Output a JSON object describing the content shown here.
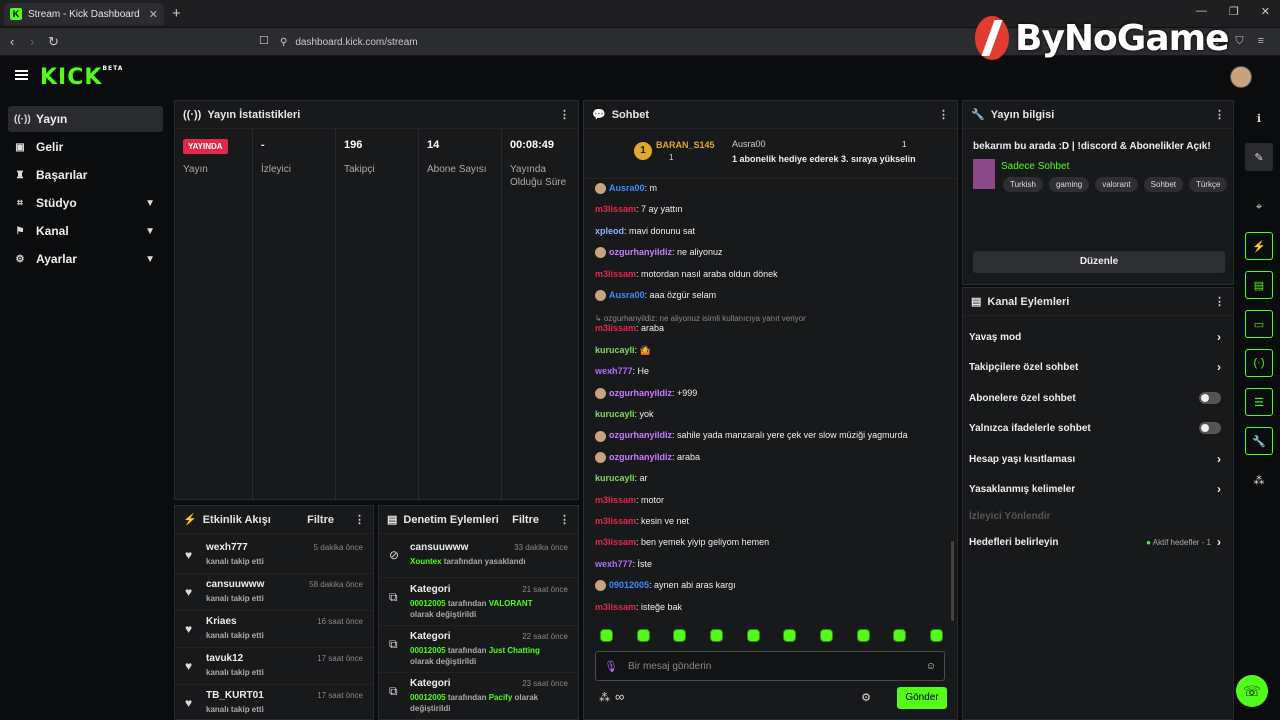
{
  "browser": {
    "tab_title": "Stream - Kick Dashboard",
    "url": "dashboard.kick.com/stream"
  },
  "watermark": "ByNoGame",
  "logo": "KICK",
  "logo_badge": "BETA",
  "nav": [
    {
      "label": "Yayın",
      "icon": "broadcast-icon",
      "active": true
    },
    {
      "label": "Gelir",
      "icon": "revenue-icon"
    },
    {
      "label": "Başarılar",
      "icon": "trophy-icon"
    },
    {
      "label": "Stüdyo",
      "icon": "studio-icon",
      "expandable": true
    },
    {
      "label": "Kanal",
      "icon": "channel-icon",
      "expandable": true
    },
    {
      "label": "Ayarlar",
      "icon": "gear-icon",
      "expandable": true
    }
  ],
  "stats": {
    "title": "Yayın İstatistikleri",
    "live_badge": "YAYINDA",
    "columns": [
      {
        "value": "",
        "label": "Yayın"
      },
      {
        "value": "-",
        "label": "İzleyici"
      },
      {
        "value": "196",
        "label": "Takipçi"
      },
      {
        "value": "14",
        "label": "Abone Sayısı"
      },
      {
        "value": "00:08:49",
        "label": "Yayında Olduğu Süre"
      }
    ]
  },
  "activity": {
    "title": "Etkinlik Akışı",
    "filter": "Filtre",
    "items": [
      {
        "name": "wexh777",
        "sub": "kanalı takip etti",
        "time": "5 dakika önce"
      },
      {
        "name": "cansuuwww",
        "sub": "kanalı takip etti",
        "time": "58 dakika önce"
      },
      {
        "name": "Kriaes",
        "sub": "kanalı takip etti",
        "time": "16 saat önce"
      },
      {
        "name": "tavuk12",
        "sub": "kanalı takip etti",
        "time": "17 saat önce"
      },
      {
        "name": "TB_KURT01",
        "sub": "kanalı takip etti",
        "time": "17 saat önce"
      }
    ]
  },
  "moderation": {
    "title": "Denetim Eylemleri",
    "filter": "Filtre",
    "items": [
      {
        "name": "cansuuwww",
        "by": "Xountex",
        "rest": " tarafından yasaklandı",
        "time": "33 dakika önce",
        "icon": "ban-icon"
      },
      {
        "name": "Kategori",
        "by": "00012005",
        "mid": " tarafından ",
        "cat": "VALORANT",
        "rest": " olarak değiştirildi",
        "time": "21 saat önce",
        "icon": "category-icon"
      },
      {
        "name": "Kategori",
        "by": "00012005",
        "mid": " tarafından ",
        "cat": "Just Chatting",
        "rest": " olarak değiştirildi",
        "time": "22 saat önce",
        "icon": "category-icon"
      },
      {
        "name": "Kategori",
        "by": "00012005",
        "mid": " tarafından ",
        "cat": "Pacify",
        "rest": " olarak değiştirildi",
        "time": "23 saat önce",
        "icon": "category-icon"
      }
    ]
  },
  "chat": {
    "title": "Sohbet",
    "pinned": {
      "rank": "1",
      "user1": "BARAN_S145",
      "count1": "1",
      "user2": "Ausra00",
      "message": "1 abonelik hediye ederek 3. sıraya yükselin",
      "count2": "1"
    },
    "messages": [
      {
        "user": "Ausra00",
        "color": "#3d8bff",
        "text": ": m",
        "avatar": true
      },
      {
        "user": "m3lissam",
        "color": "#e0284a",
        "text": ": 7 ay yattın"
      },
      {
        "user": "xpleod",
        "color": "#8fb3ff",
        "text": ": mavi donunu sat"
      },
      {
        "user": "ozgurhanyildiz",
        "color": "#c77dff",
        "text": ": ne aliyonuz",
        "avatar": true
      },
      {
        "user": "m3lissam",
        "color": "#e0284a",
        "text": ": motordan nasıl araba oldun dönek"
      },
      {
        "user": "Ausra00",
        "color": "#3d8bff",
        "text": ": aaa özgür selam",
        "avatar": true
      },
      {
        "reply": "ozgurhanyildiz: ne aliyonuz isimli kullanıcıya yanıt veriyor"
      },
      {
        "user": "m3lissam",
        "color": "#e0284a",
        "text": ": araba"
      },
      {
        "user": "kurucayli",
        "color": "#7ed957",
        "text": ": 🤷"
      },
      {
        "user": "wexh777",
        "color": "#b36bff",
        "text": ": He"
      },
      {
        "user": "ozgurhanyildiz",
        "color": "#c77dff",
        "text": ": +999",
        "avatar": true
      },
      {
        "user": "kurucayli",
        "color": "#7ed957",
        "text": ": yok"
      },
      {
        "user": "ozgurhanyildiz",
        "color": "#c77dff",
        "text": ": sahile yada manzaralı yere çek ver slow müziği yagmurda",
        "avatar": true
      },
      {
        "user": "ozgurhanyildiz",
        "color": "#c77dff",
        "text": ": araba",
        "avatar": true
      },
      {
        "user": "kurucayli",
        "color": "#7ed957",
        "text": ": ar"
      },
      {
        "user": "m3lissam",
        "color": "#e0284a",
        "text": ": motor"
      },
      {
        "user": "m3lissam",
        "color": "#e0284a",
        "text": ": kesin ve net"
      },
      {
        "user": "m3lissam",
        "color": "#e0284a",
        "text": ": ben yemek yiyip geliyom hemen"
      },
      {
        "user": "wexh777",
        "color": "#b36bff",
        "text": ": İste"
      },
      {
        "user": "09012005",
        "color": "#3d8bff",
        "text": ": aynen abi aras kargı",
        "avatar": true
      },
      {
        "user": "m3lissam",
        "color": "#e0284a",
        "text": ": isteğe bak"
      }
    ],
    "placeholder": "Bir mesaj gönderin",
    "send": "Gönder",
    "points": "∞"
  },
  "stream_info": {
    "title": "Yayın bilgisi",
    "stream_title": "bekarım bu arada :D | !discord & Abonelikler Açık!",
    "category": "Sadece Sohbet",
    "tags": [
      "Turkish",
      "gaming",
      "valorant",
      "Sohbet",
      "Türkçe"
    ],
    "edit": "Düzenle"
  },
  "channel_actions": {
    "title": "Kanal Eylemleri",
    "items": [
      {
        "label": "Yavaş mod",
        "type": "arrow"
      },
      {
        "label": "Takipçilere özel sohbet",
        "type": "arrow"
      },
      {
        "label": "Abonelere özel sohbet",
        "type": "toggle"
      },
      {
        "label": "Yalnızca ifadelerle sohbet",
        "type": "toggle"
      },
      {
        "label": "Hesap yaşı kısıtlaması",
        "type": "arrow"
      },
      {
        "label": "Yasaklanmış kelimeler",
        "type": "arrow"
      },
      {
        "label": "İzleyici Yönlendir",
        "type": "dim"
      },
      {
        "label": "Hedefleri belirleyin",
        "type": "arrow",
        "extra": "Aktif hedefler - 1"
      }
    ]
  },
  "colors": {
    "accent": "#53fc18",
    "live": "#e0284a"
  }
}
